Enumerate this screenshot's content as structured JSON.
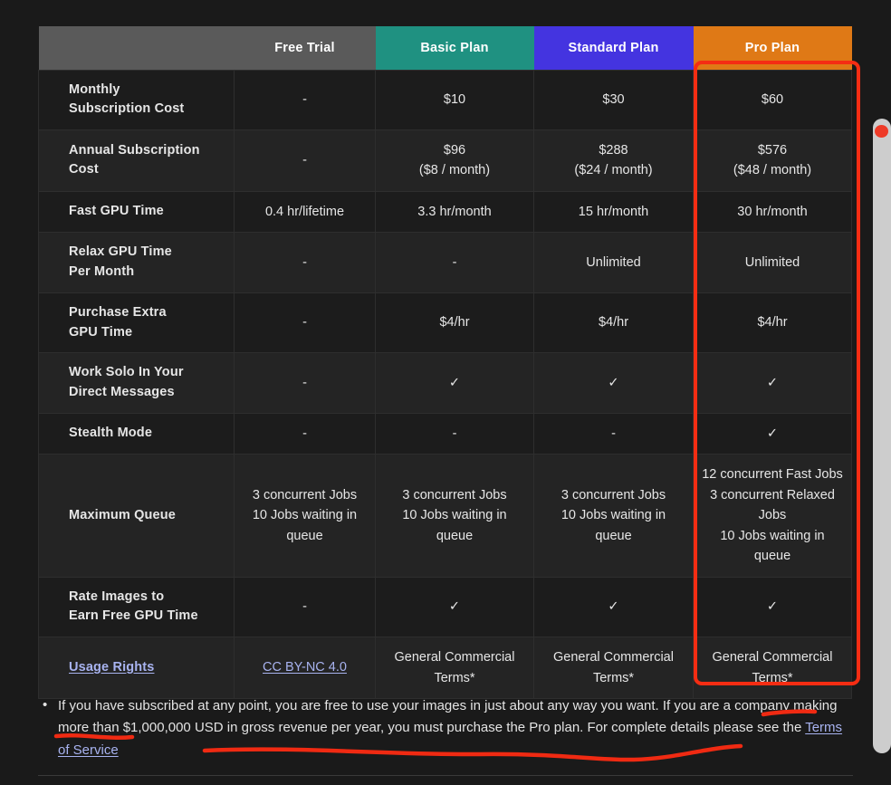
{
  "table": {
    "columns": [
      {
        "key": "feature",
        "label": "",
        "accent": "#5a5a5a"
      },
      {
        "key": "free",
        "label": "Free Trial",
        "accent": "#5a5a5a"
      },
      {
        "key": "basic",
        "label": "Basic Plan",
        "accent": "#1f9181"
      },
      {
        "key": "standard",
        "label": "Standard Plan",
        "accent": "#4434e0"
      },
      {
        "key": "pro",
        "label": "Pro Plan",
        "accent": "#df7916"
      }
    ],
    "rows": [
      {
        "feature_line1": "Monthly",
        "feature_line2": "Subscription Cost",
        "free": "-",
        "basic": "$10",
        "standard": "$30",
        "pro": "$60"
      },
      {
        "feature_line1": "Annual Subscription",
        "feature_line2": "Cost",
        "free": "-",
        "basic_line1": "$96",
        "basic_line2": "($8 / month)",
        "standard_line1": "$288",
        "standard_line2": "($24 / month)",
        "pro_line1": "$576",
        "pro_line2": "($48 / month)"
      },
      {
        "feature_line1": "Fast GPU Time",
        "feature_line2": "",
        "free": "0.4 hr/lifetime",
        "basic": "3.3 hr/month",
        "standard": "15 hr/month",
        "pro": "30 hr/month"
      },
      {
        "feature_line1": "Relax GPU Time",
        "feature_line2": "Per Month",
        "free": "-",
        "basic": "-",
        "standard": "Unlimited",
        "pro": "Unlimited"
      },
      {
        "feature_line1": "Purchase Extra",
        "feature_line2": "GPU Time",
        "free": "-",
        "basic": "$4/hr",
        "standard": "$4/hr",
        "pro": "$4/hr"
      },
      {
        "feature_line1": "Work Solo In Your",
        "feature_line2": "Direct Messages",
        "free": "-",
        "basic": "✓",
        "standard": "✓",
        "pro": "✓"
      },
      {
        "feature_line1": "Stealth Mode",
        "feature_line2": "",
        "free": "-",
        "basic": "-",
        "standard": "-",
        "pro": "✓"
      },
      {
        "feature_line1": "Maximum Queue",
        "feature_line2": "",
        "free_line1": "3 concurrent Jobs",
        "free_line2": "10 Jobs waiting in queue",
        "basic_line1": "3 concurrent Jobs",
        "basic_line2": "10 Jobs waiting in queue",
        "standard_line1": "3 concurrent Jobs",
        "standard_line2": "10 Jobs waiting in queue",
        "pro_line1": "12 concurrent Fast Jobs",
        "pro_line2": "3 concurrent Relaxed Jobs",
        "pro_line3": "10 Jobs waiting in queue"
      },
      {
        "feature_line1": "Rate Images to",
        "feature_line2": "Earn Free GPU Time",
        "free": "-",
        "basic": "✓",
        "standard": "✓",
        "pro": "✓"
      },
      {
        "feature_link": "Usage Rights",
        "free_link": "CC BY-NC 4.0",
        "basic_line1": "General Commercial",
        "basic_line2": "Terms*",
        "standard_line1": "General Commercial",
        "standard_line2": "Terms*",
        "pro_line1": "General Commercial",
        "pro_line2": "Terms*"
      }
    ]
  },
  "footnote": {
    "text_before_link": "If you have subscribed at any point, you are free to use your images in just about any way you want. If you are a company making more than $1,000,000 USD in gross revenue per year, you must purchase the Pro plan. For complete details please see the ",
    "link_text": "Terms of Service"
  },
  "annotations": {
    "highlight_color": "#f52d13",
    "box_target": "Pro Plan",
    "underline_count": 3
  }
}
